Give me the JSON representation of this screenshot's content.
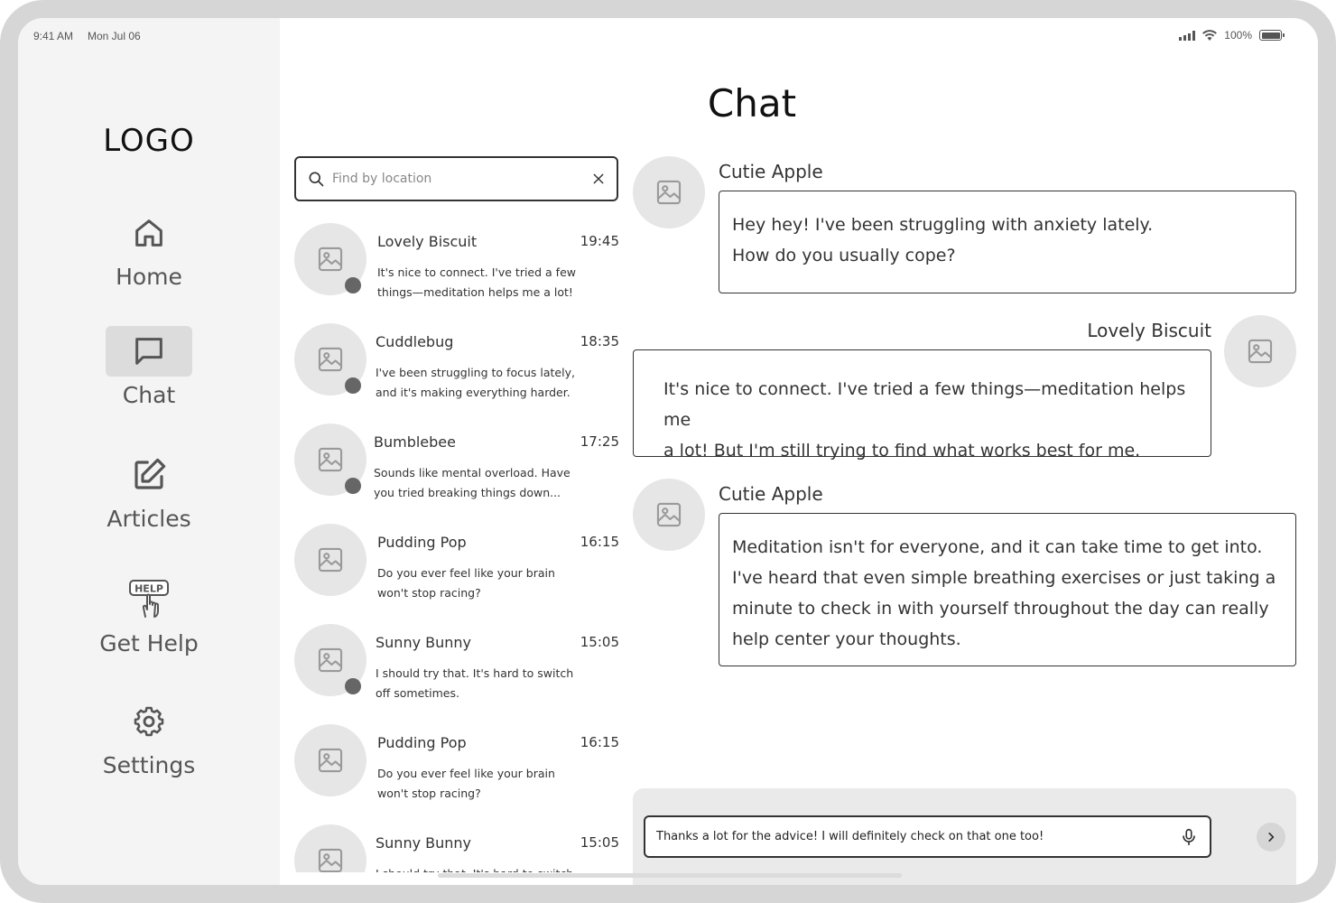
{
  "status_bar": {
    "time": "9:41 AM",
    "date": "Mon Jul 06",
    "battery": "100%"
  },
  "sidebar": {
    "logo": "LOGO",
    "items": [
      {
        "label": "Home",
        "icon": "home-icon",
        "active": false
      },
      {
        "label": "Chat",
        "icon": "chat-icon",
        "active": true
      },
      {
        "label": "Articles",
        "icon": "edit-icon",
        "active": false
      },
      {
        "label": "Get Help",
        "icon": "help-icon",
        "active": false
      },
      {
        "label": "Settings",
        "icon": "gear-icon",
        "active": false
      }
    ]
  },
  "page": {
    "title": "Chat"
  },
  "search": {
    "placeholder": "Find by location",
    "value": ""
  },
  "conversations": [
    {
      "name": "Lovely Biscuit",
      "time": "19:45",
      "message": "It's nice to connect. I've tried a few things—meditation helps me a lot!"
    },
    {
      "name": "Cuddlebug",
      "time": "18:35",
      "message": "I've been struggling to focus lately, and it's making everything harder."
    },
    {
      "name": "Bumblebee",
      "time": "17:25",
      "message": "Sounds like mental overload. Have you tried breaking things down..."
    },
    {
      "name": "Pudding Pop",
      "time": "16:15",
      "message": "Do you ever feel like your brain won't stop racing?"
    },
    {
      "name": "Sunny Bunny",
      "time": "15:05",
      "message": "I should try that. It's hard to switch off sometimes."
    },
    {
      "name": "Pudding Pop",
      "time": "16:15",
      "message": "Do you ever feel like your brain won't stop racing?"
    },
    {
      "name": "Sunny Bunny",
      "time": "15:05",
      "message": "I should try that. It's hard to switch off sometimes."
    }
  ],
  "messages": [
    {
      "sender": "Cutie Apple",
      "lines": [
        "Hey hey! I've been struggling with anxiety lately.",
        "How do you usually cope?"
      ]
    },
    {
      "sender": "Lovely Biscuit",
      "lines": [
        "It's nice to connect. I've tried a few things—meditation helps me",
        "a lot! But I'm still trying to find what works best for me."
      ]
    },
    {
      "sender": "Cutie Apple",
      "lines": [
        "Meditation isn't for everyone, and it can take time to get into.",
        "I've heard that even simple breathing exercises or just taking a",
        "minute to check in with yourself throughout the day can really",
        "help center your thoughts."
      ]
    }
  ],
  "compose": {
    "value": "Thanks a lot for the advice! I will definitely check on that one too!"
  }
}
